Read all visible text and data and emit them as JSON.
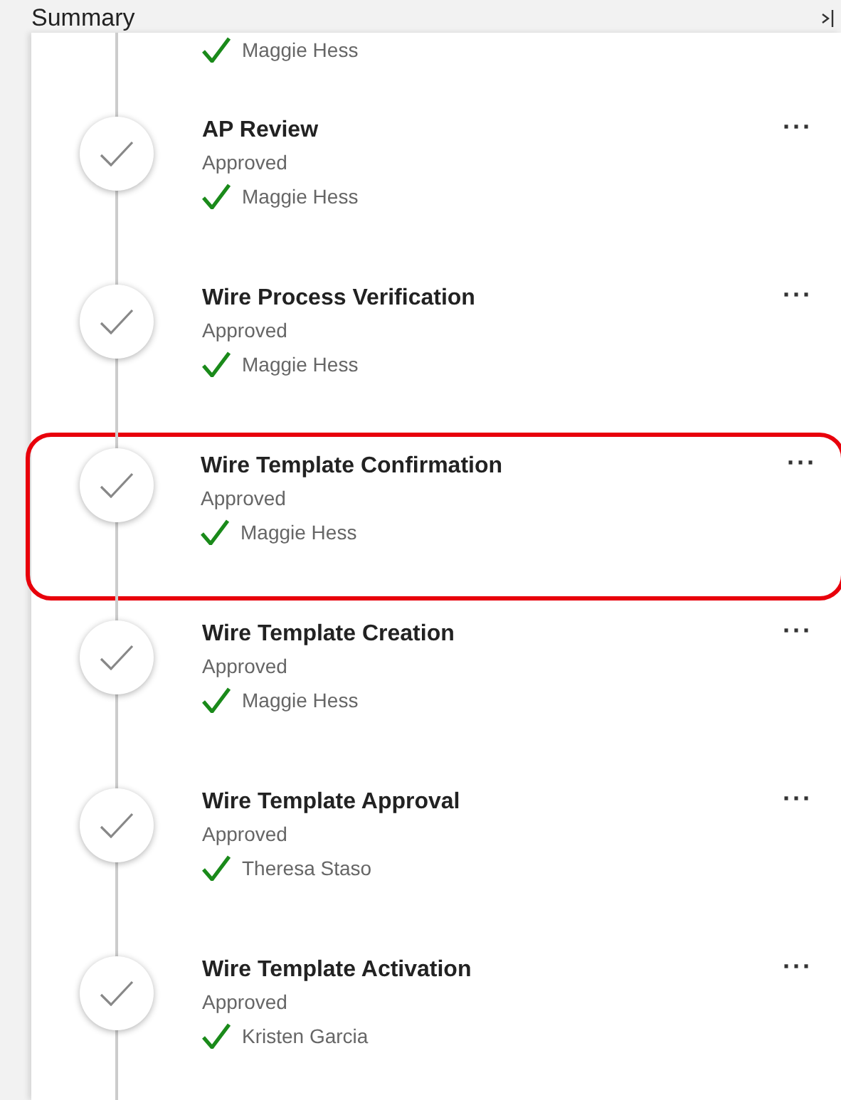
{
  "header": {
    "title": "Summary"
  },
  "partial_step": {
    "approver": "Maggie Hess"
  },
  "steps": [
    {
      "title": "AP Review",
      "status": "Approved",
      "approver": "Maggie Hess",
      "highlighted": false
    },
    {
      "title": "Wire Process Verification",
      "status": "Approved",
      "approver": "Maggie Hess",
      "highlighted": false
    },
    {
      "title": "Wire Template Confirmation",
      "status": "Approved",
      "approver": "Maggie Hess",
      "highlighted": true
    },
    {
      "title": "Wire Template Creation",
      "status": "Approved",
      "approver": "Maggie Hess",
      "highlighted": false
    },
    {
      "title": "Wire Template Approval",
      "status": "Approved",
      "approver": "Theresa Staso",
      "highlighted": false
    },
    {
      "title": "Wire Template Activation",
      "status": "Approved",
      "approver": "Kristen Garcia",
      "highlighted": false
    }
  ],
  "more_label": "···"
}
